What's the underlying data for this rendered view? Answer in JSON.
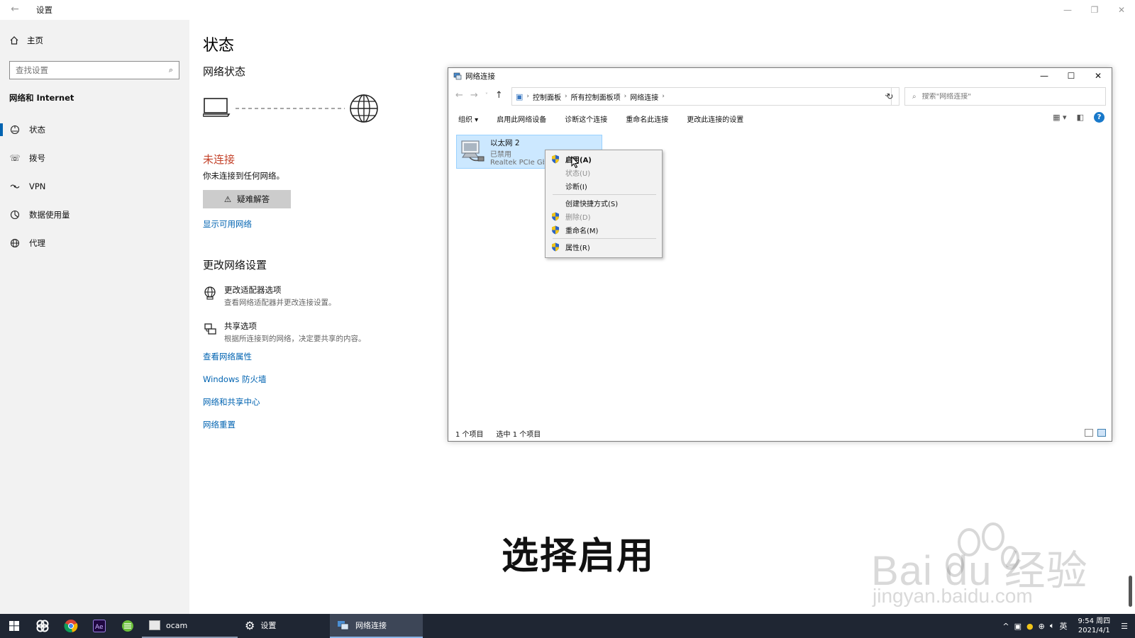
{
  "settings": {
    "title": "设置",
    "home": "主页",
    "search_placeholder": "查找设置",
    "section": "网络和 Internet",
    "nav": [
      {
        "label": "状态",
        "icon": "network-status-icon"
      },
      {
        "label": "拨号",
        "icon": "dialup-icon"
      },
      {
        "label": "VPN",
        "icon": "vpn-icon"
      },
      {
        "label": "数据使用量",
        "icon": "data-usage-icon"
      },
      {
        "label": "代理",
        "icon": "proxy-globe-icon"
      }
    ],
    "page_title": "状态",
    "network_status_title": "网络状态",
    "connection_status": "未连接",
    "connection_desc": "你未连接到任何网络。",
    "troubleshoot": "疑难解答",
    "show_networks": "显示可用网络",
    "change_title": "更改网络设置",
    "options": [
      {
        "title": "更改适配器选项",
        "desc": "查看网络适配器并更改连接设置。"
      },
      {
        "title": "共享选项",
        "desc": "根据所连接到的网络，决定要共享的内容。"
      }
    ],
    "links": [
      "查看网络属性",
      "Windows 防火墙",
      "网络和共享中心",
      "网络重置"
    ]
  },
  "explorer": {
    "title": "网络连接",
    "breadcrumb": [
      "控制面板",
      "所有控制面板项",
      "网络连接"
    ],
    "search_placeholder": "搜索\"网络连接\"",
    "commands": [
      "组织 ▾",
      "启用此网络设备",
      "诊断这个连接",
      "重命名此连接",
      "更改此连接的设置"
    ],
    "item": {
      "name": "以太网 2",
      "status": "已禁用",
      "device": "Realtek PCIe GbE"
    },
    "status_count": "1 个项目",
    "status_selected": "选中 1 个项目"
  },
  "context_menu": {
    "items": [
      {
        "label": "启用(A)",
        "shield": true,
        "disabled": false,
        "bold": true
      },
      {
        "label": "状态(U)",
        "shield": false,
        "disabled": true,
        "bold": false
      },
      {
        "label": "诊断(I)",
        "shield": false,
        "disabled": false,
        "bold": false
      },
      {
        "label": "创建快捷方式(S)",
        "shield": false,
        "disabled": false,
        "bold": false
      },
      {
        "label": "删除(D)",
        "shield": true,
        "disabled": true,
        "bold": false
      },
      {
        "label": "重命名(M)",
        "shield": true,
        "disabled": false,
        "bold": false
      },
      {
        "label": "属性(R)",
        "shield": true,
        "disabled": false,
        "bold": false
      }
    ]
  },
  "overlay": {
    "subtitle": "选择启用",
    "watermark_main": "Bai du 经验",
    "watermark_url": "jingyan.baidu.com"
  },
  "taskbar": {
    "apps": [
      "ocam",
      "设置",
      "网络连接"
    ],
    "ime": "英",
    "time": "9:54 周四",
    "date": "2021/4/1"
  },
  "colors": {
    "accent": "#0063b1",
    "disconnected": "#c4432b",
    "selection": "#cce8ff",
    "taskbar": "#1f2633"
  }
}
